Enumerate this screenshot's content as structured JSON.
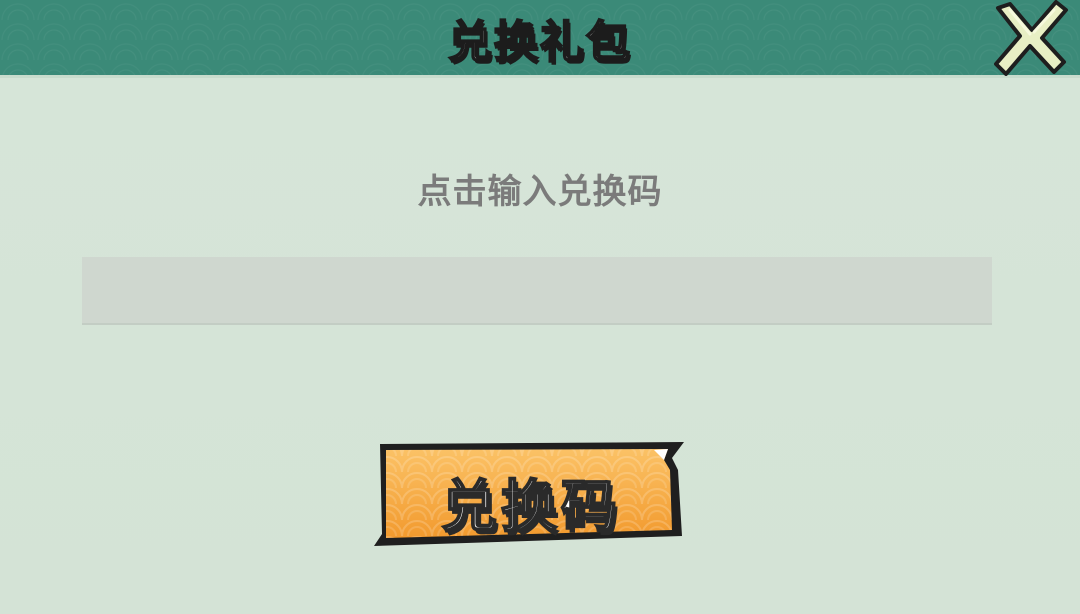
{
  "header": {
    "title": "兑换礼包",
    "close_icon": "close-x-icon"
  },
  "form": {
    "prompt": "点击输入兑换码",
    "code_value": "",
    "code_placeholder": ""
  },
  "redeem_button": {
    "label": "兑换码"
  },
  "colors": {
    "header_bg": "#3b8a78",
    "panel_bg": "#d6e5d8",
    "input_bg": "#cfd7cf",
    "button_orange": "#f6a23a",
    "prompt_text": "#7b7b7b"
  }
}
